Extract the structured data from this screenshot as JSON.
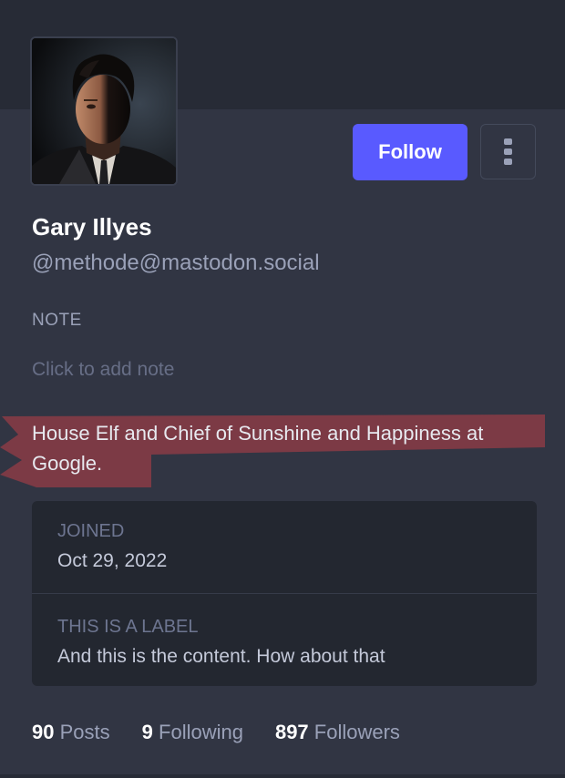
{
  "profile": {
    "display_name": "Gary Illyes",
    "handle": "@methode@mastodon.social",
    "bio": "House Elf and Chief of Sunshine and Happiness at Google."
  },
  "actions": {
    "follow_label": "Follow",
    "menu_icon": "vertical-ellipsis-icon"
  },
  "note": {
    "heading": "NOTE",
    "placeholder": "Click to add note"
  },
  "fields": [
    {
      "label": "JOINED",
      "value": "Oct 29, 2022"
    },
    {
      "label": "THIS IS A LABEL",
      "value": "And this is the content. How about that"
    }
  ],
  "stats": [
    {
      "count": "90",
      "label": "Posts"
    },
    {
      "count": "9",
      "label": "Following"
    },
    {
      "count": "897",
      "label": "Followers"
    }
  ],
  "colors": {
    "accent": "#595aff",
    "background": "#313543",
    "highlight": "#8a3b45"
  }
}
